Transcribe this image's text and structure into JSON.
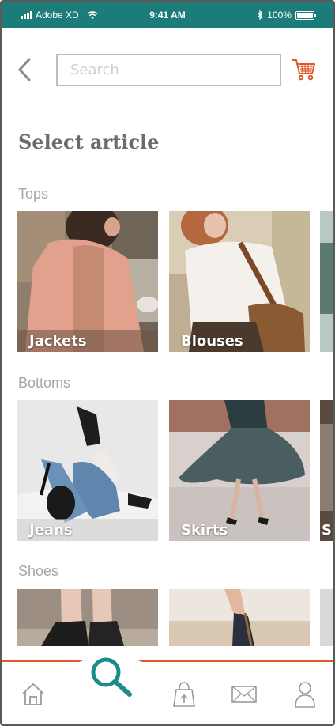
{
  "status_bar": {
    "carrier": "Adobe XD",
    "time": "9:41 AM",
    "battery": "100%",
    "battery_level": 1.0
  },
  "header": {
    "search_placeholder": "Search",
    "back_icon": "chevron-left-icon",
    "cart_icon": "cart-icon"
  },
  "page_title": "Select article",
  "sections": [
    {
      "label": "Tops",
      "items": [
        {
          "label": "Jackets"
        },
        {
          "label": "Blouses"
        },
        {
          "label": ""
        }
      ]
    },
    {
      "label": "Bottoms",
      "items": [
        {
          "label": "Jeans"
        },
        {
          "label": "Skirts"
        },
        {
          "label": "S"
        }
      ]
    },
    {
      "label": "Shoes",
      "items": [
        {
          "label": ""
        },
        {
          "label": ""
        },
        {
          "label": ""
        }
      ]
    }
  ],
  "bottom_nav": {
    "items": [
      "home-icon",
      "search-icon",
      "shopping-bag-icon",
      "mail-icon",
      "user-icon"
    ],
    "active": "search-icon"
  },
  "colors": {
    "status_bar": "#1c7c7a",
    "accent": "#e0582b",
    "active_icon": "#1c8c8a",
    "title": "#6b6b6b",
    "label": "#a6a6a6"
  }
}
